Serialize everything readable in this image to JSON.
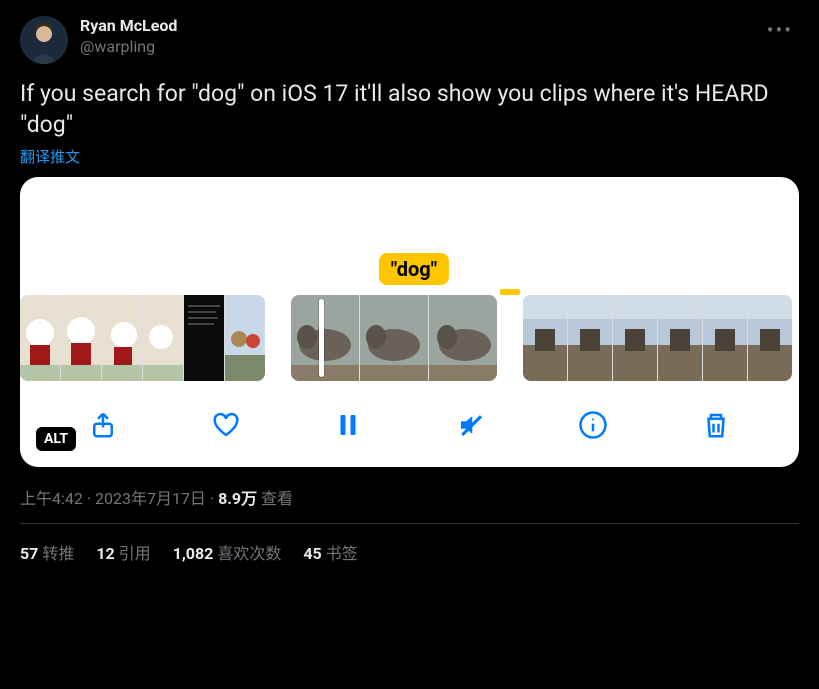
{
  "user": {
    "display_name": "Ryan McLeod",
    "handle": "@warpling"
  },
  "tweet_text": "If you search for \"dog\" on iOS 17 it'll also show you clips where it's HEARD \"dog\"",
  "translate_label": "翻译推文",
  "media": {
    "tag_label": "\"dog\"",
    "alt_label": "ALT"
  },
  "meta": {
    "time": "上午4:42",
    "date": "2023年7月17日",
    "views_number": "8.9万",
    "views_label": "查看"
  },
  "stats": {
    "retweets_count": "57",
    "retweets_label": "转推",
    "quotes_count": "12",
    "quotes_label": "引用",
    "likes_count": "1,082",
    "likes_label": "喜欢次数",
    "bookmarks_count": "45",
    "bookmarks_label": "书签"
  }
}
